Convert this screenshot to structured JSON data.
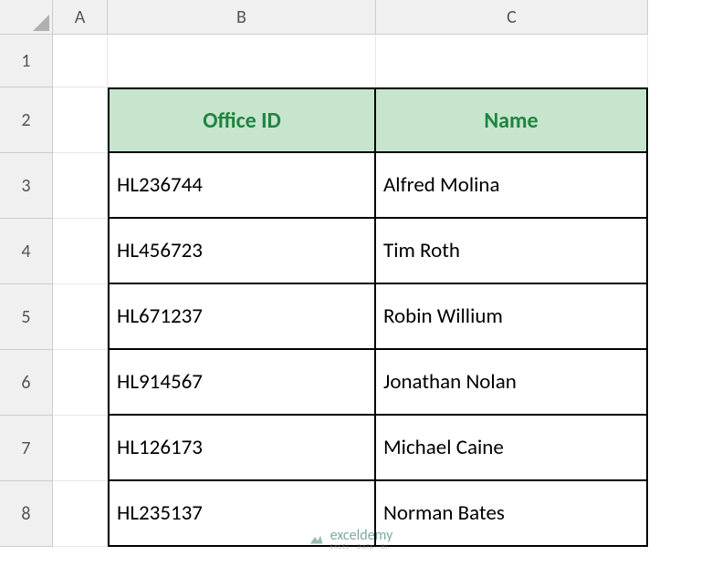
{
  "columns": [
    "A",
    "B",
    "C"
  ],
  "rows": [
    "1",
    "2",
    "3",
    "4",
    "5",
    "6",
    "7",
    "8"
  ],
  "headers": {
    "col1": "Office ID",
    "col2": "Name"
  },
  "data": [
    {
      "id": "HL236744",
      "name": "Alfred Molina"
    },
    {
      "id": "HL456723",
      "name": "Tim Roth"
    },
    {
      "id": "HL671237",
      "name": "Robin Willium"
    },
    {
      "id": "HL914567",
      "name": "Jonathan Nolan"
    },
    {
      "id": "HL126173",
      "name": "Michael Caine"
    },
    {
      "id": "HL235137",
      "name": "Norman Bates"
    }
  ],
  "watermark": {
    "main": "exceldemy",
    "sub": "EXCEL · DATA · BI"
  }
}
